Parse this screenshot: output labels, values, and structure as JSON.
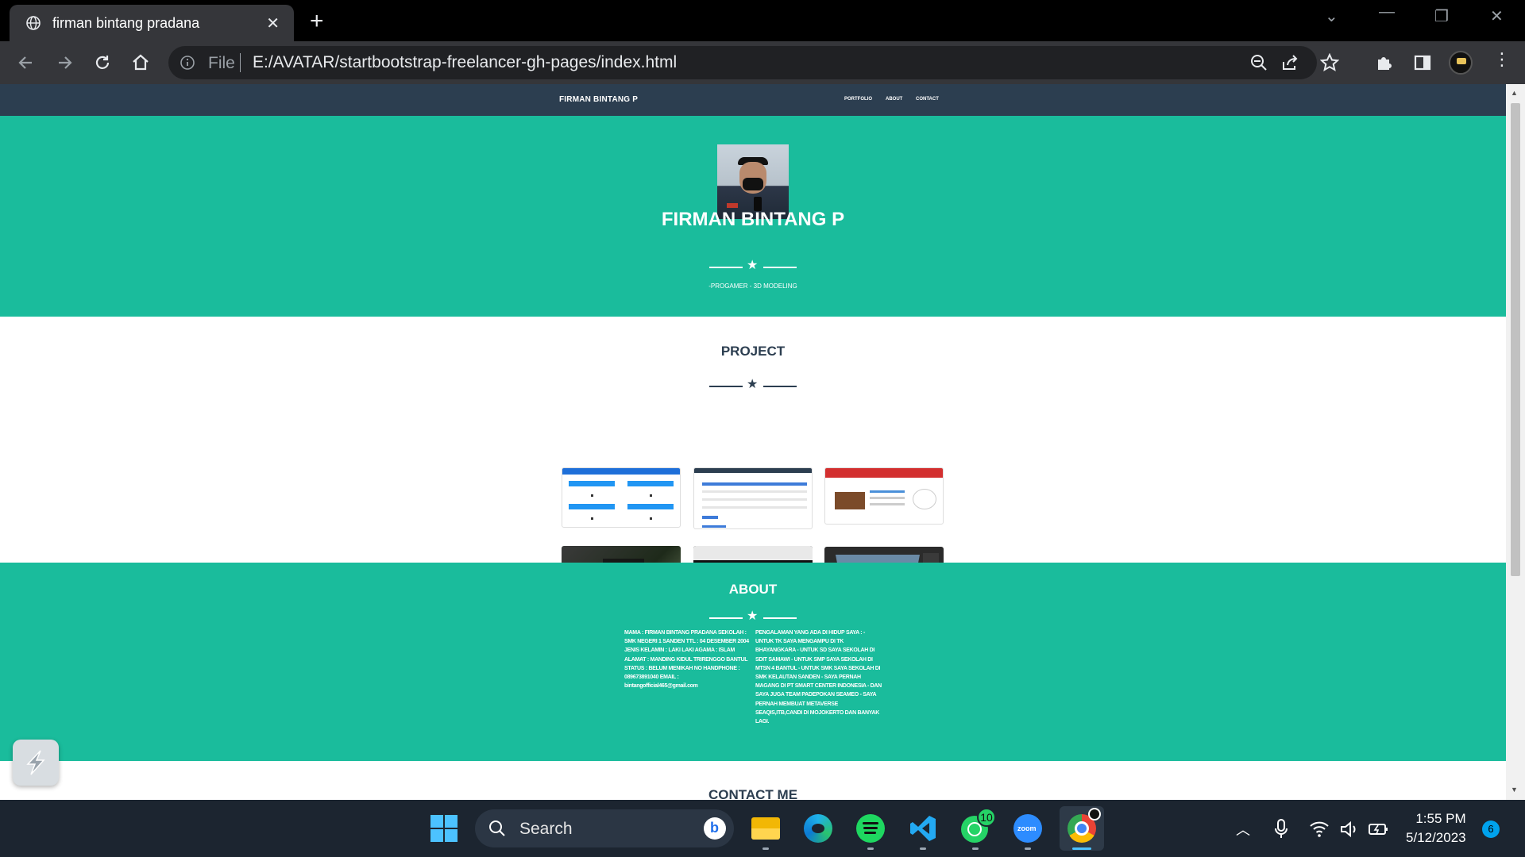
{
  "browser": {
    "tab_title": "firman bintang pradana",
    "new_tab": "+",
    "file_label": "File",
    "url": "E:/AVATAR/startbootstrap-freelancer-gh-pages/index.html"
  },
  "site": {
    "brand": "FIRMAN BINTANG P",
    "nav": [
      "PORTFOLIO",
      "ABOUT",
      "CONTACT"
    ],
    "masthead": {
      "name": "FIRMAN BINTANG P",
      "subtitle": "-PROGAMER - 3D MODELING"
    },
    "portfolio": {
      "heading": "PROJECT",
      "thumbnails": [
        "web-project-1",
        "web-project-2",
        "web-project-3",
        "motorbike-login",
        "metaverse-gallery",
        "3d-modeling-scene"
      ]
    },
    "about": {
      "heading": "ABOUT",
      "left": "MAMA : FIRMAN BINTANG PRADANA SEKOLAH : SMK NEGERI 1 SANDEN TTL : 04 DESEMBER 2004 JENIS KELAMIN : LAKI LAKI AGAMA : ISLAM ALAMAT : MANDING KIDUL TRIRENGGO BANTUL STATUS : BELUM MENIKAH NO HANDPHONE : 089673891040 EMAIL : bintangofficial465@gmail.com",
      "right": "PENGALAMAN YANG ADA DI HIDUP SAYA : - UNTUK TK SAYA MENGAMPU DI TK BHAYANGKARA - UNTUK SD SAYA SEKOLAH DI SDIT SAMAWI - UNTUK SMP SAYA SEKOLAH DI MTSN 4 BANTUL - UNTUK SMK SAYA SEKOLAH DI SMK KELAUTAN SANDEN - SAYA PERNAH MAGANG DI PT SMART CENTER INDONESIA - DAN SAYA JUGA TEAM PADEPOKAN SEAMEO - SAYA PERNAH MEMBUAT METAVERSE SEAQIS,ITB,CANDI DI MOJOKERTO DAN BANYAK LAGI."
    },
    "contact": {
      "heading": "CONTACT ME"
    }
  },
  "taskbar": {
    "search_label": "Search",
    "whatsapp_badge": "10",
    "time": "1:55 PM",
    "date": "5/12/2023",
    "notifications": "6"
  },
  "colors": {
    "navbar": "#2c3e50",
    "teal": "#1abc9c",
    "text_dark": "#2c3e50"
  }
}
